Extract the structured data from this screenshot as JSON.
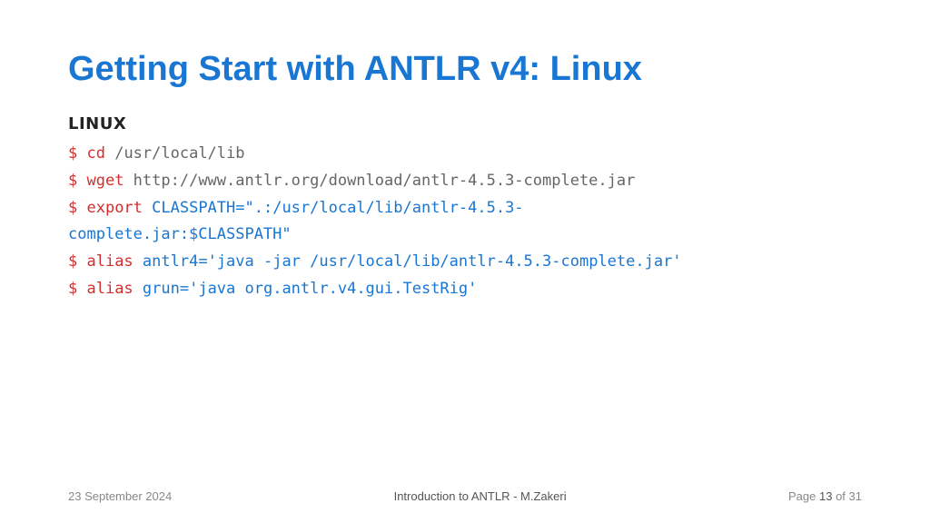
{
  "title": "Getting Start with ANTLR v4: Linux",
  "subhead": "LINUX",
  "lines": {
    "l1": {
      "prompt": "$",
      "cmd": "cd",
      "arg": "/usr/local/lib"
    },
    "l2": {
      "prompt": "$",
      "cmd": "wget",
      "arg": "http://www.antlr.org/download/antlr-4.5.3-complete.jar"
    },
    "l3": {
      "prompt": "$",
      "cmd": "export",
      "kw": "CLASSPATH=",
      "strA": "\".:/usr/local/lib/antlr-4.5.3-",
      "strB": "complete.jar:$CLASSPATH\""
    },
    "l4": {
      "prompt": "$",
      "cmd": "alias",
      "kw": "antlr4=",
      "str": "'java -jar /usr/local/lib/antlr-4.5.3-complete.jar'"
    },
    "l5": {
      "prompt": "$",
      "cmd": "alias",
      "kw": "grun=",
      "str": "'java org.antlr.v4.gui.TestRig'"
    }
  },
  "footer": {
    "date": "23 September 2024",
    "center": "Introduction to ANTLR - M.Zakeri",
    "page_label": "Page",
    "page_num": "13",
    "page_of": "of 31"
  }
}
